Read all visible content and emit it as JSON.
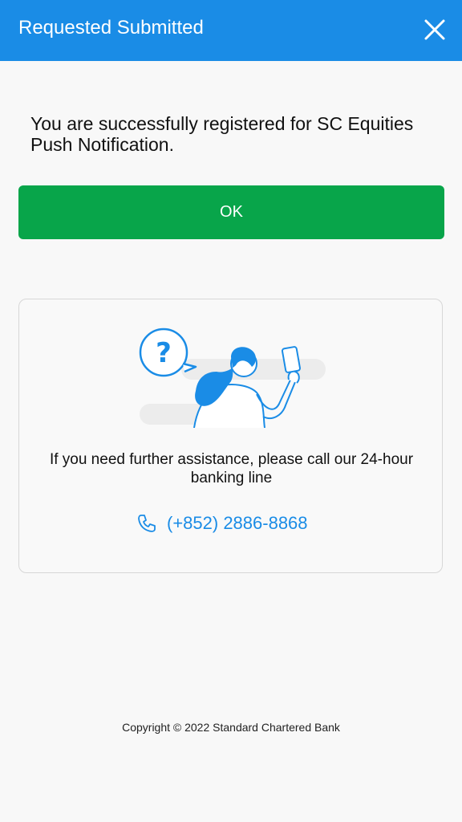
{
  "header": {
    "title": "Requested Submitted",
    "close_icon": "close-icon"
  },
  "main": {
    "message": "You are successfully registered for SC Equities Push Notification.",
    "ok_label": "OK"
  },
  "help": {
    "illustration": "person-with-phone-question-illustration",
    "text": "If you need further assistance, please call our 24-hour banking line",
    "phone_icon": "phone-icon",
    "phone_number": "(+852) 2886-8868"
  },
  "footer": {
    "copyright": "Copyright © 2022 Standard Chartered Bank"
  },
  "colors": {
    "header_bg": "#1a8ce6",
    "ok_button": "#08a54a",
    "link": "#1a8ce6"
  }
}
